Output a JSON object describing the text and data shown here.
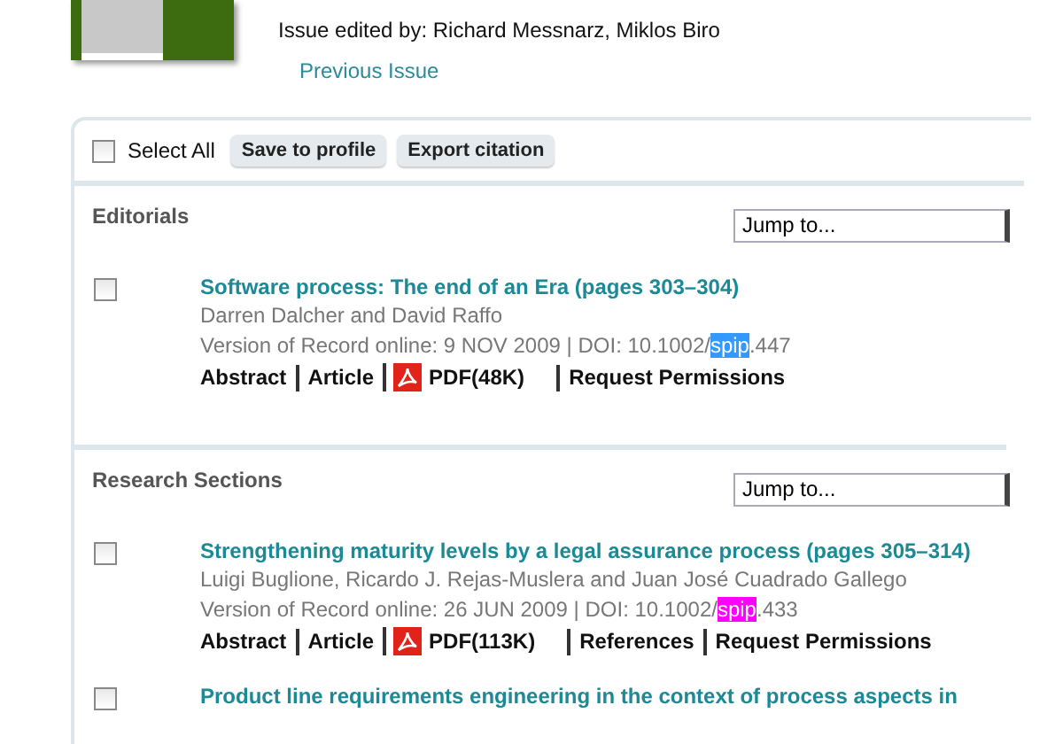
{
  "issue": {
    "editors": "Issue edited by: Richard Messnarz, Miklos Biro",
    "previous_link": "Previous Issue"
  },
  "toolbar": {
    "select_all": {
      "label": "Select All",
      "checked": false
    },
    "buttons": [
      "Save to profile",
      "Export citation"
    ]
  },
  "sections": [
    {
      "heading": "Editorials",
      "jump_placeholder": "Jump to...",
      "articles": [
        {
          "checked": false,
          "title": "Software process: The end of an Era (pages 303–304)",
          "authors": "Darren Dalcher and David Raffo",
          "record": "Version of Record online: 9 NOV 2009 | DOI: 10.1002/",
          "highlight": "spip",
          "color": "#3399ff",
          "doi_rest": ".447",
          "links": [
            {
              "kind": "text",
              "label": "Abstract"
            },
            {
              "kind": "text",
              "label": "Article"
            },
            {
              "kind": "pdf",
              "label": "PDF(48K)"
            },
            {
              "kind": "text",
              "label": "Request Permissions"
            }
          ]
        }
      ]
    },
    {
      "heading": "Research Sections",
      "jump_placeholder": "Jump to...",
      "articles": [
        {
          "checked": false,
          "title": "Strengthening maturity levels by a legal assurance process (pages 305–314)",
          "authors": "Luigi Buglione, Ricardo J. Rejas-Muslera and Juan José Cuadrado Gallego",
          "record": "Version of Record online: 26 JUN 2009 | DOI: 10.1002/",
          "highlight": "spip",
          "color": "#ff00ff",
          "doi_rest": ".433",
          "links": [
            {
              "kind": "text",
              "label": "Abstract"
            },
            {
              "kind": "text",
              "label": "Article"
            },
            {
              "kind": "pdf",
              "label": "PDF(113K)"
            },
            {
              "kind": "text",
              "label": "References"
            },
            {
              "kind": "text",
              "label": "Request Permissions"
            }
          ]
        },
        {
          "checked": false,
          "title": "Product line requirements engineering in the context of process aspects in"
        }
      ]
    }
  ]
}
